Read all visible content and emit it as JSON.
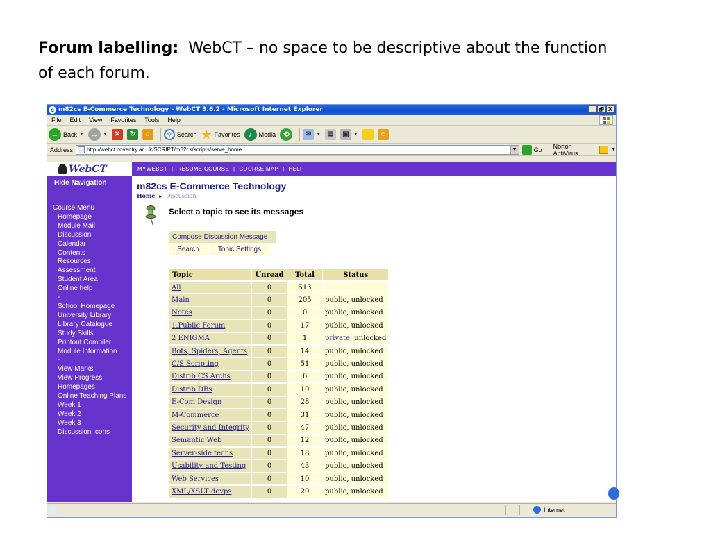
{
  "slide": {
    "heading_bold": "Forum labelling:",
    "heading_rest": "WebCT – no space to be descriptive about the function",
    "heading_line2": "of each forum."
  },
  "window": {
    "title": "m82cs E-Commerce Technology - WebCT 3.6.2 - Microsoft Internet Explorer",
    "controls": [
      "_",
      "🗗",
      "X"
    ]
  },
  "menubar": [
    "File",
    "Edit",
    "View",
    "Favorites",
    "Tools",
    "Help"
  ],
  "toolbar": {
    "back": "Back",
    "search": "Search",
    "favorites": "Favorites",
    "media": "Media"
  },
  "addressbar": {
    "label": "Address",
    "url": "http://webct.coventry.ac.uk/SCRIPT/m82cs/scripts/serve_home",
    "go": "Go",
    "norton": "Norton AntiVirus"
  },
  "sidebar": {
    "logo": "WebCT",
    "hide_nav": "Hide Navigation",
    "menu_title": "Course Menu",
    "items_a": [
      "Homepage",
      "Module Mail",
      "Discussion",
      "Calendar",
      "Contents",
      "Resources",
      "Assessment",
      "Student Area",
      "Online help"
    ],
    "sep1": "-",
    "items_b": [
      "School Homepage",
      "University Library",
      "Library Catalogue",
      "Study Skills",
      "Printout Compiler",
      "Module Information"
    ],
    "sep2": "-",
    "items_c": [
      "View Marks",
      "View Progress",
      "Homepages",
      "Online Teaching Plans",
      "Week 1",
      "Week 2",
      "Week 3",
      "Discussion Icons"
    ]
  },
  "navstrip": [
    "MYWEBCT",
    "RESUME COURSE",
    "COURSE MAP",
    "HELP"
  ],
  "content": {
    "course_title": "m82cs E-Commerce Technology",
    "crumb_home": "Home",
    "crumb_current": "Discussion",
    "select_topic": "Select a topic to see its messages",
    "compose": "Compose Discussion Message",
    "search": "Search",
    "topic_settings": "Topic Settings"
  },
  "table": {
    "headers": [
      "Topic",
      "Unread",
      "Total",
      "Status"
    ],
    "rows": [
      {
        "topic": "All",
        "unread": "0",
        "total": "513",
        "status": ""
      },
      {
        "topic": "Main",
        "unread": "0",
        "total": "205",
        "status": "public, unlocked"
      },
      {
        "topic": "Notes",
        "unread": "0",
        "total": "0",
        "status": "public, unlocked"
      },
      {
        "topic": "1.Public Forum",
        "unread": "0",
        "total": "17",
        "status": "public, unlocked"
      },
      {
        "topic": "2 ENIGMA",
        "unread": "0",
        "total": "1",
        "status_link": "private",
        "status": ", unlocked"
      },
      {
        "topic": "Bots, Spiders, Agents",
        "unread": "0",
        "total": "14",
        "status": "public, unlocked"
      },
      {
        "topic": "C/S Scripting",
        "unread": "0",
        "total": "51",
        "status": "public, unlocked"
      },
      {
        "topic": "Distrib CS Archs",
        "unread": "0",
        "total": "6",
        "status": "public, unlocked"
      },
      {
        "topic": "Distrib DBs",
        "unread": "0",
        "total": "10",
        "status": "public, unlocked"
      },
      {
        "topic": "E-Com Design",
        "unread": "0",
        "total": "28",
        "status": "public, unlocked"
      },
      {
        "topic": "M-Commerce",
        "unread": "0",
        "total": "31",
        "status": "public, unlocked"
      },
      {
        "topic": "Security and Integrity",
        "unread": "0",
        "total": "47",
        "status": "public, unlocked"
      },
      {
        "topic": "Semantic Web",
        "unread": "0",
        "total": "12",
        "status": "public, unlocked"
      },
      {
        "topic": "Server-side techs",
        "unread": "0",
        "total": "18",
        "status": "public, unlocked"
      },
      {
        "topic": "Usability and Testing",
        "unread": "0",
        "total": "43",
        "status": "public, unlocked"
      },
      {
        "topic": "Web Services",
        "unread": "0",
        "total": "10",
        "status": "public, unlocked"
      },
      {
        "topic": "XML/XSLT devps",
        "unread": "0",
        "total": "20",
        "status": "public, unlocked"
      }
    ]
  },
  "statusbar": {
    "zone": "Internet"
  }
}
